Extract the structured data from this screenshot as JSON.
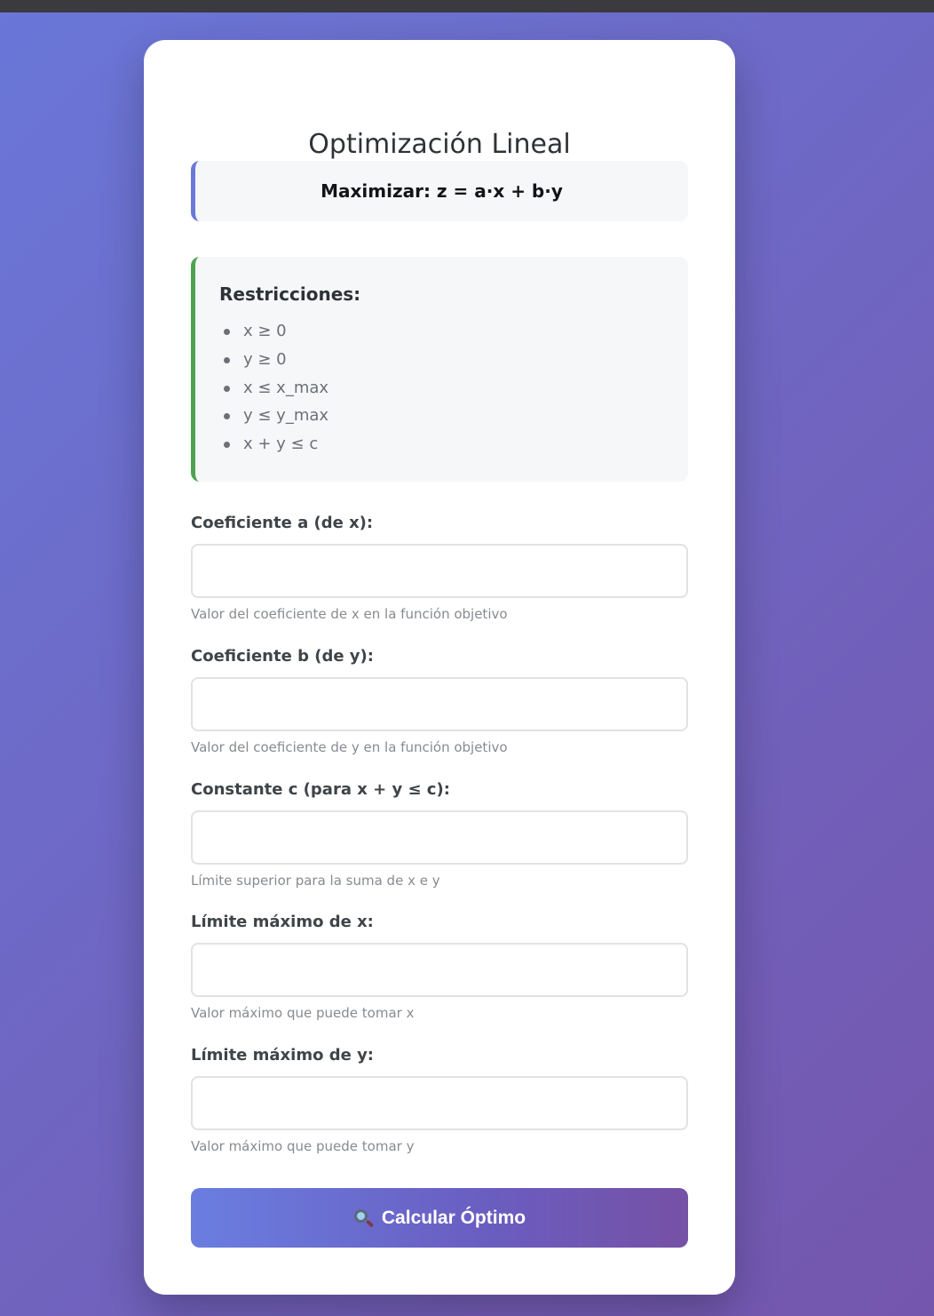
{
  "title": "Optimización Lineal",
  "objective": "Maximizar: z = a·x + b·y",
  "constraints": {
    "heading": "Restricciones:",
    "items": [
      "x ≥ 0",
      "y ≥ 0",
      "x ≤ x_max",
      "y ≤ y_max",
      "x + y ≤ c"
    ]
  },
  "fields": [
    {
      "label": "Coeficiente a (de x):",
      "value": "",
      "help": "Valor del coeficiente de x en la función objetivo"
    },
    {
      "label": "Coeficiente b (de y):",
      "value": "",
      "help": "Valor del coeficiente de y en la función objetivo"
    },
    {
      "label": "Constante c (para x + y ≤ c):",
      "value": "",
      "help": "Límite superior para la suma de x e y"
    },
    {
      "label": "Límite máximo de x:",
      "value": "",
      "help": "Valor máximo que puede tomar x"
    },
    {
      "label": "Límite máximo de y:",
      "value": "",
      "help": "Valor máximo que puede tomar y"
    }
  ],
  "button": {
    "label": "Calcular Óptimo",
    "icon": "magnifying-glass-icon"
  },
  "colors": {
    "objective_accent": "#6b79d9",
    "constraints_accent": "#4fa350",
    "gradient_start": "#6a7ee0",
    "gradient_end": "#7651a5"
  }
}
